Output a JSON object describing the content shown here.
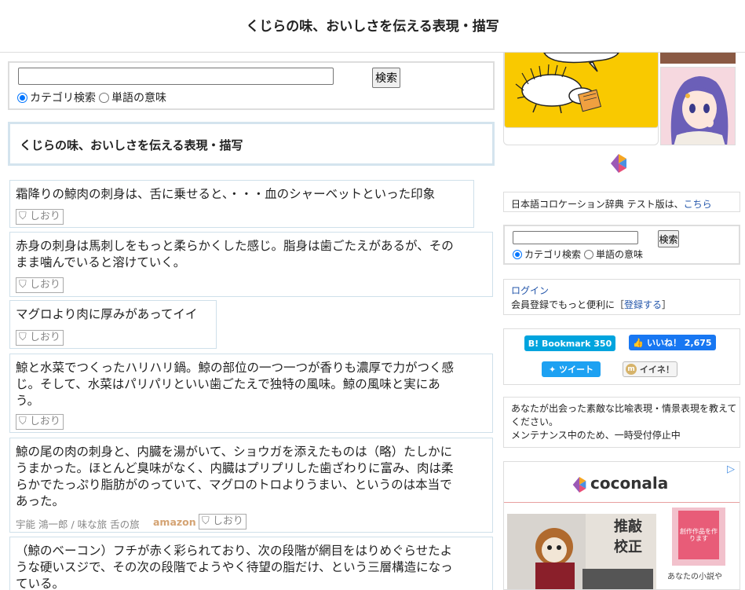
{
  "header": {
    "title": "くじらの味、おいしさを伝える表現・描写"
  },
  "search": {
    "button_label": "検索",
    "option_category": "カテゴリ検索",
    "option_word": "単語の意味",
    "selected": "カテゴリ検索"
  },
  "topic": {
    "title": "くじらの味、おいしさを伝える表現・描写"
  },
  "entries": [
    {
      "text": "霜降りの鯨肉の刺身は、舌に乗せると、・・・血のシャーベットといった印象",
      "bookmark": "しおり"
    },
    {
      "text_lines": [
        "赤身の刺身は馬刺しをもっと柔らかくした感じ。脂身は歯ごたえがあるが、その",
        "まま噛んでいると溶けていく。"
      ],
      "bookmark": "しおり"
    },
    {
      "text": "マグロより肉に厚みがあってイイ",
      "bookmark": "しおり"
    },
    {
      "text_lines": [
        "鯨と水菜でつくったハリハリ鍋。鯨の部位の一つ一つが香りも濃厚で力がつく感",
        "じ。そして、水菜はパリパリといい歯ごたえで独特の風味。鯨の風味と実にあ",
        "う。"
      ],
      "bookmark": "しおり"
    },
    {
      "text_lines": [
        "鯨の尾の肉の刺身と、内臓を湯がいて、ショウガを添えたものは（略）たしかに",
        "うまかった。ほとんど臭味がなく、内臓はプリプリした歯ざわりに富み、肉は柔",
        "らかでたっぷり脂肪がのっていて、マグロのトロよりうまい、というのは本当で",
        "あった。"
      ],
      "source": "宇能 鴻一郎 / 味な旅 舌の旅",
      "amazon": "amazon",
      "bookmark": "しおり"
    },
    {
      "text_lines": [
        "（鯨のベーコン）フチが赤く彩られており、次の段階が網目をはりめぐらせたよ",
        "うな硬いスジで、その次の段階でようやく待望の脂だけ、という三層構造になっ",
        "ている。"
      ]
    }
  ],
  "sidebar": {
    "beta_notice": "日本語コロケーション辞典 テスト版は、",
    "beta_link": "こちら",
    "search": {
      "button_label": "検索",
      "option_category": "カテゴリ検索",
      "option_word": "単語の意味"
    },
    "login_link": "ログイン",
    "register_text": "会員登録でもっと便利に［",
    "register_link": "登録する",
    "register_close": "］",
    "social": {
      "hatena_label": "B! Bookmark",
      "hatena_count": "350",
      "fb_label": "いいね！",
      "fb_count": "2,675",
      "tweet_label": "ツイート",
      "mixi_label": "イイネ！"
    },
    "submit_notice_lines": [
      "あなたが出会った素敵な比喩表現・情景表現を教えて",
      "ください。",
      "メンテナンス中のため、一時受付停止中"
    ]
  },
  "ads": {
    "coconala_brand": "coconala",
    "ad_choices_label": "▷",
    "sign_line1": "推敲",
    "sign_line2": "校正",
    "book_caption": "あなたの小説や",
    "book_cover_text": "創作作品を作ります"
  },
  "colors": {
    "accent_link": "#2255aa",
    "radio_selected": "#0075ff",
    "ad_yellow": "#f9c900",
    "hatena": "#00a4de",
    "facebook": "#1877f2",
    "twitter": "#1da1f2",
    "amazon": "#d4a373"
  }
}
